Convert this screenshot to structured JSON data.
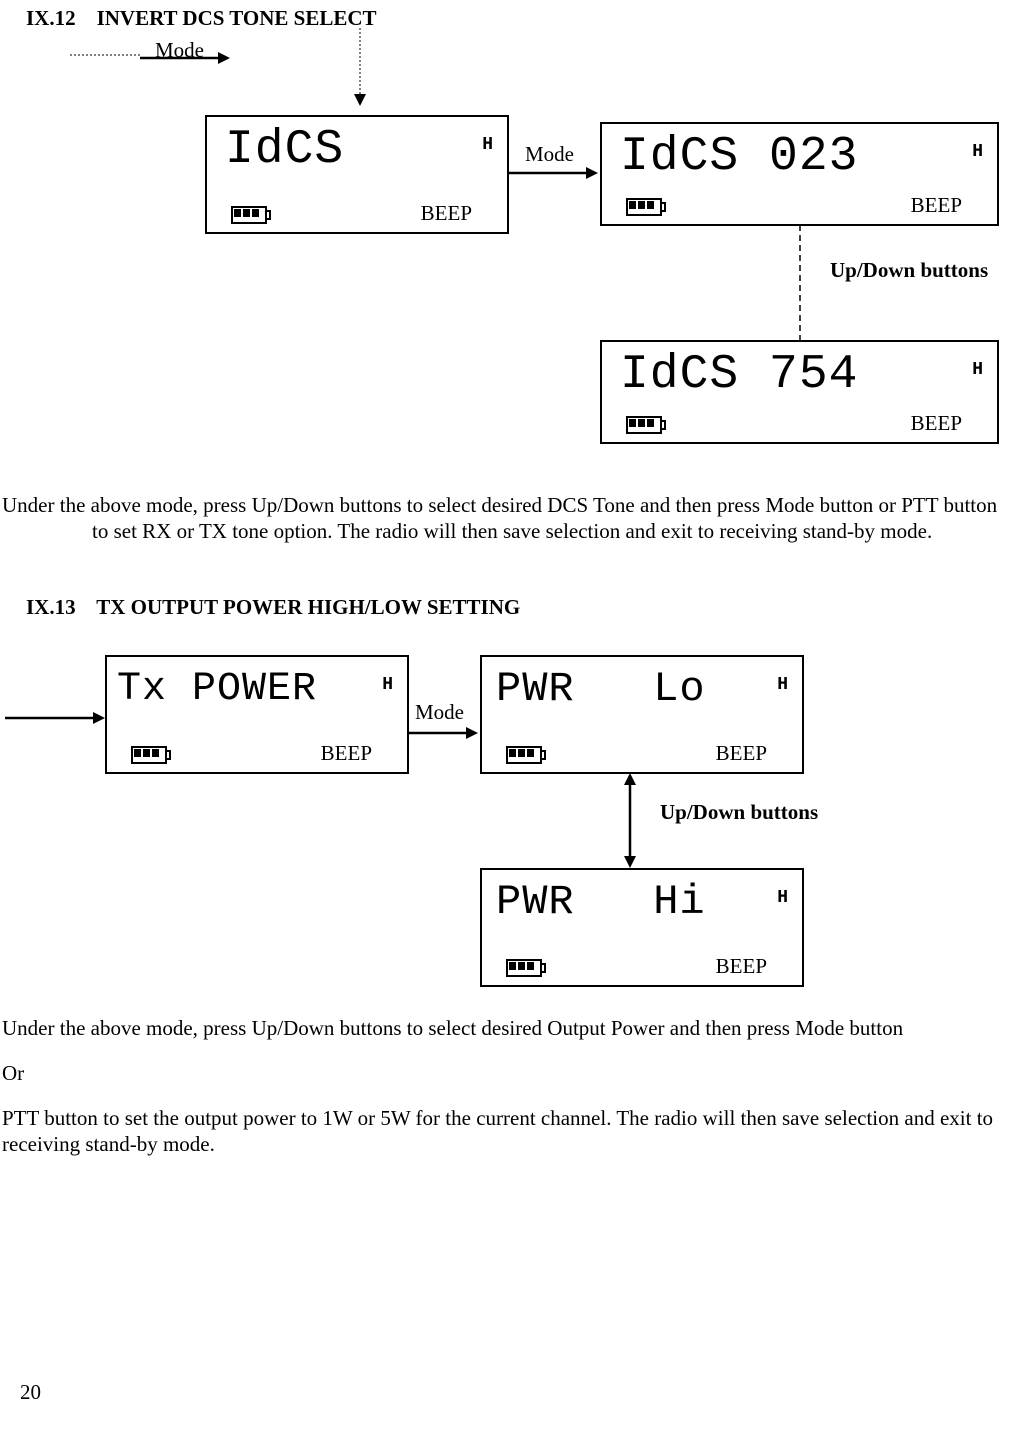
{
  "section12": {
    "heading_num": "IX.12",
    "heading_title": "INVERT DCS TONE SELECT",
    "mode_top_label": "Mode",
    "mode_arrow_label": "Mode",
    "updown_label": "Up/Down buttons",
    "lcd1": {
      "main": "IdCS",
      "beep": "BEEP",
      "h": "H"
    },
    "lcd2": {
      "main": "IdCS 023",
      "beep": "BEEP",
      "h": "H"
    },
    "lcd3": {
      "main": "IdCS 754",
      "beep": "BEEP",
      "h": "H"
    },
    "paragraph": "Under the above mode, press Up/Down buttons to select desired DCS Tone and then press Mode button or PTT button to set RX or TX tone option. The radio will then save selection and exit to receiving stand-by mode."
  },
  "section13": {
    "heading_num": "IX.13",
    "heading_title": "TX OUTPUT POWER HIGH/LOW SETTING",
    "mode_arrow_label": "Mode",
    "updown_label": "Up/Down buttons",
    "lcd1": {
      "main": "Tx POWER",
      "beep": "BEEP",
      "h": "H"
    },
    "lcd2": {
      "main": "PWR   Lo",
      "beep": "BEEP",
      "h": "H"
    },
    "lcd3": {
      "main": "PWR   Hi",
      "beep": "BEEP",
      "h": "H"
    },
    "paragraph1": "Under the above mode, press Up/Down buttons to select desired Output Power and then press Mode button",
    "paragraph_or": "Or",
    "paragraph2": "PTT button to set the output power to 1W or 5W for the current channel. The radio will then save selection and exit to receiving stand-by mode."
  },
  "page_number": "20"
}
